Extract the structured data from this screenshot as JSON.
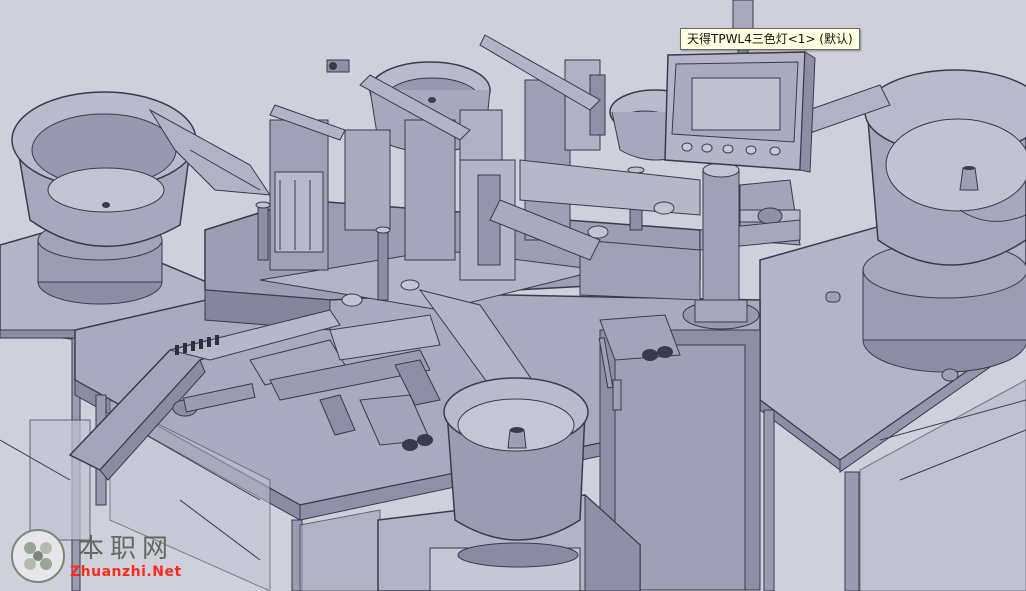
{
  "viewport": {
    "background_color": "#cfd0dc",
    "model_color": "#a2a3b8",
    "edge_color": "#3a3a4c",
    "highlight_color": "#c6c7d8",
    "shadow_color": "#7b7c93"
  },
  "tooltip": {
    "text": "天得TPWL4三色灯<1> (默认)"
  },
  "watermark": {
    "title": "本职网",
    "url": "Zhuanzhi.Net",
    "url_color": "#ff2a1a"
  }
}
